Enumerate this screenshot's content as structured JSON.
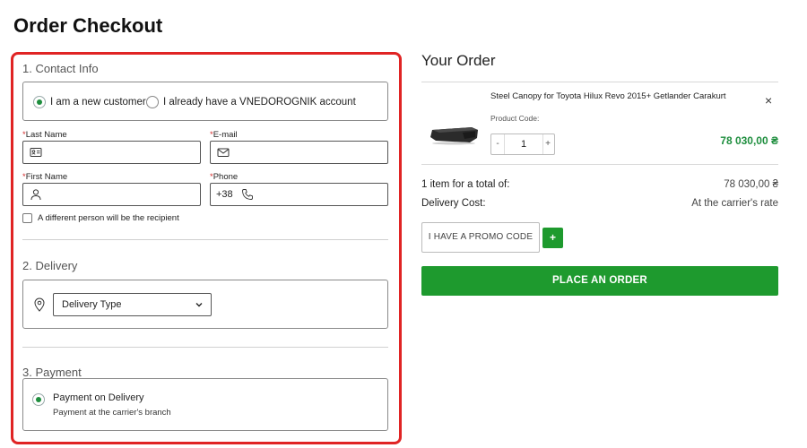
{
  "page": {
    "title": "Order Checkout"
  },
  "contact": {
    "section_title": "1. Contact Info",
    "radio_new": "I am a new customer",
    "radio_existing": "I already have a VNEDOROGNIK account",
    "last_name_label": "Last Name",
    "email_label": "E-mail",
    "first_name_label": "First Name",
    "phone_label": "Phone",
    "phone_prefix": "+38",
    "required_mark": "*",
    "different_recipient_label": "A different person will be the recipient"
  },
  "delivery": {
    "section_title": "2. Delivery",
    "select_value": "Delivery Type"
  },
  "payment": {
    "section_title": "3. Payment",
    "option_title": "Payment on Delivery",
    "option_subtitle": "Payment at the carrier's branch"
  },
  "order": {
    "title": "Your Order",
    "product_name": "Steel Canopy for Toyota Hilux Revo 2015+ Getlander Carakurt",
    "product_code_label": "Product Code:",
    "quantity": "1",
    "minus": "-",
    "plus": "+",
    "remove": "×",
    "price": "78 030,00 ₴",
    "total_label": "1 item for a total of:",
    "total_value": "78 030,00 ₴",
    "delivery_cost_label": "Delivery Cost:",
    "delivery_cost_value": "At the carrier's rate",
    "promo_label": "I HAVE A PROMO CODE",
    "promo_add": "+",
    "place_order_label": "PLACE AN ORDER"
  },
  "colors": {
    "accent_green": "#1e9a2e",
    "highlight_red": "#e02424"
  },
  "icons": [
    "id-card-icon",
    "envelope-icon",
    "person-icon",
    "phone-icon",
    "location-pin-icon",
    "chevron-down-icon",
    "close-icon"
  ]
}
